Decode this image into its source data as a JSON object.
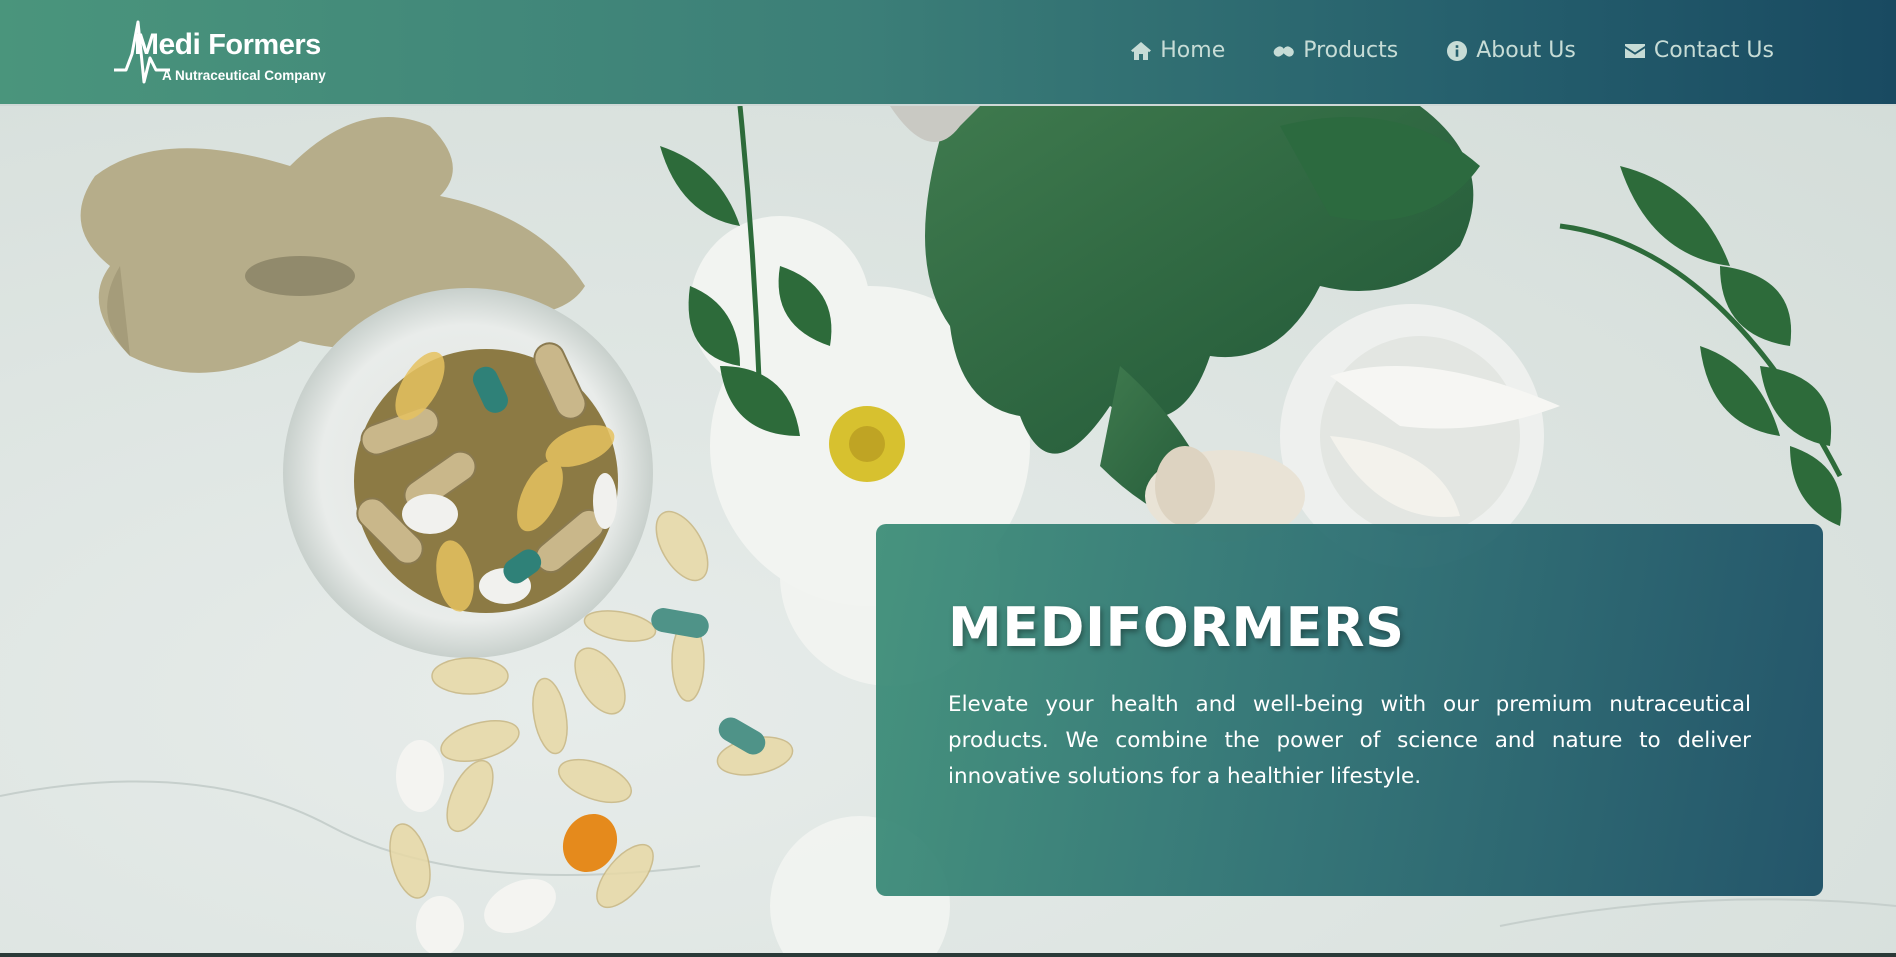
{
  "brand": {
    "name_part1": "Medi",
    "name_part2": "Formers",
    "tagline": "A Nutraceutical Company"
  },
  "nav": {
    "items": [
      {
        "label": "Home",
        "icon": "home-icon"
      },
      {
        "label": "Products",
        "icon": "capsules-icon"
      },
      {
        "label": "About Us",
        "icon": "info-circle-icon"
      },
      {
        "label": "Contact Us",
        "icon": "envelope-icon"
      }
    ]
  },
  "hero": {
    "title": "MEDIFORMERS",
    "description": "Elevate your health and well-being with our premium nutraceutical products. We combine the power of science and nature to deliver innovative solutions for a healthier lifestyle."
  },
  "colors": {
    "header_start": "#4a957c",
    "header_end": "#194a61",
    "card_start": "#3a8c76",
    "card_end": "#1a4e64",
    "nav_text": "#c7dcd6"
  }
}
